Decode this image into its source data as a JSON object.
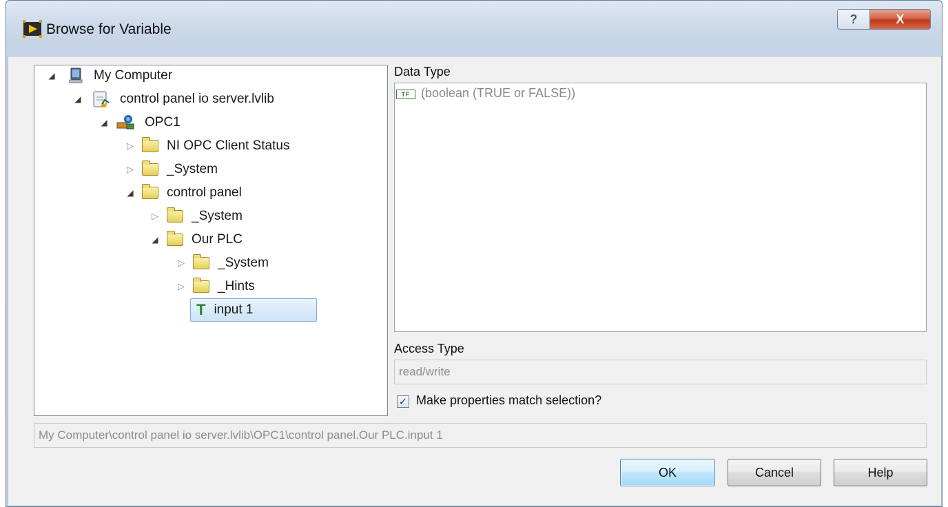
{
  "window": {
    "title": "Browse for Variable",
    "help_glyph": "?",
    "close_glyph": "X"
  },
  "tree": {
    "nodes": [
      {
        "label": "My Computer",
        "icon": "computer-icon",
        "expanded": true
      },
      {
        "label": "control panel io server.lvlib",
        "icon": "library-icon",
        "expanded": true
      },
      {
        "label": "OPC1",
        "icon": "io-server-icon",
        "expanded": true
      },
      {
        "label": "NI OPC Client Status",
        "icon": "folder-icon",
        "expanded": false
      },
      {
        "label": "_System",
        "icon": "folder-icon",
        "expanded": false
      },
      {
        "label": "control panel",
        "icon": "folder-icon",
        "expanded": true
      },
      {
        "label": "_System",
        "icon": "folder-icon",
        "expanded": false
      },
      {
        "label": "Our PLC",
        "icon": "folder-icon",
        "expanded": true
      },
      {
        "label": "_System",
        "icon": "folder-icon",
        "expanded": false
      },
      {
        "label": "_Hints",
        "icon": "folder-icon",
        "expanded": false
      },
      {
        "label": "input 1",
        "icon": "tag-icon",
        "selected": true
      }
    ]
  },
  "details": {
    "data_type_label": "Data Type",
    "data_type_icon_text": "TF",
    "data_type_value": "(boolean (TRUE or FALSE))",
    "access_type_label": "Access Type",
    "access_type_value": "read/write",
    "match_checkbox_label": "Make properties match selection?",
    "match_checked": true,
    "checkmark": "✓"
  },
  "path": "My Computer\\control panel io server.lvlib\\OPC1\\control panel.Our PLC.input 1",
  "buttons": {
    "ok": "OK",
    "cancel": "Cancel",
    "help": "Help"
  },
  "colors": {
    "selection": "#cde3f8",
    "close_button": "#c0391d",
    "default_button_border": "#3c7fb1"
  }
}
